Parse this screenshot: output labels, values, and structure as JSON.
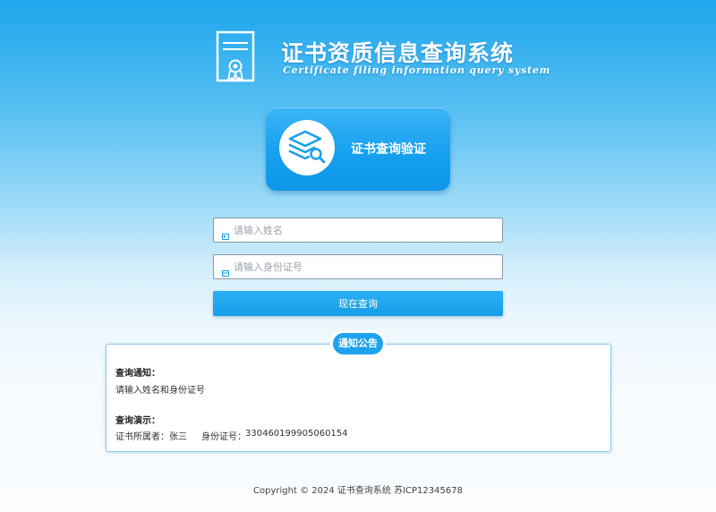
{
  "header": {
    "logo_icon": "certificate-icon",
    "title_cn": "证书资质信息查询系统",
    "title_en": "Certificate filing information query system"
  },
  "verify_card": {
    "icon": "layers-search-icon",
    "label": "证书查询验证"
  },
  "form": {
    "name_field": {
      "icon": "id-card-icon",
      "placeholder": "请输入姓名",
      "value": ""
    },
    "id_field": {
      "icon": "card-icon",
      "placeholder": "请输入身份证号",
      "value": ""
    },
    "submit_label": "现在查询"
  },
  "notice": {
    "badge": "通知公告",
    "query_notice_title": "查询通知：",
    "query_notice_text": "请输入姓名和身份证号",
    "demo_title": "查询演示：",
    "demo_owner_label": "证书所属者：",
    "demo_owner_value": "张三",
    "demo_id_label": "身份证号：",
    "demo_id_value": "330460199905060154"
  },
  "footer": {
    "text": "Copyright © 2024 证书查询系统 苏ICP12345678"
  },
  "colors": {
    "accent": "#1ea3ec",
    "button": "#149ee9",
    "text": "#333333"
  }
}
